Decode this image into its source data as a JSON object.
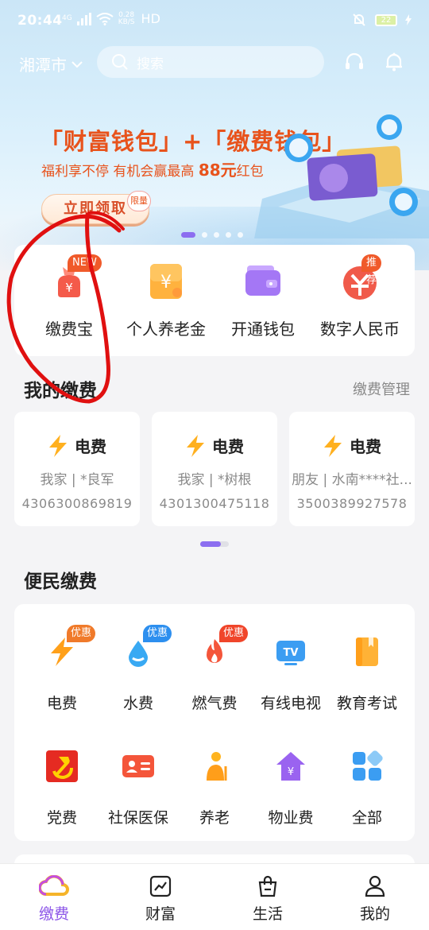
{
  "status_bar": {
    "time": "20:44",
    "network": "4G",
    "speed_value": "0.28",
    "speed_unit": "KB/S",
    "hd": "HD",
    "battery": "22"
  },
  "header": {
    "city": "湘潭市",
    "search_placeholder": "搜索"
  },
  "banner": {
    "title": "「财富钱包」+「缴费钱包」",
    "subtitle_pre": "福利享不停 有机会赢最高",
    "subtitle_amount": "88元",
    "subtitle_post": "红包",
    "claim_label": "立即领取",
    "limit_tag": "限量",
    "slides": 5,
    "active_slide": 1
  },
  "quick_actions": [
    {
      "label": "缴费宝",
      "badge": "NEW",
      "icon": "money-bag-icon"
    },
    {
      "label": "个人养老金",
      "badge": "",
      "icon": "yuan-box-icon"
    },
    {
      "label": "开通钱包",
      "badge": "",
      "icon": "wallet-icon"
    },
    {
      "label": "数字人民币",
      "badge": "推荐",
      "icon": "digital-rmb-icon"
    }
  ],
  "my_bills": {
    "title": "我的缴费",
    "manage_label": "缴费管理",
    "items": [
      {
        "type": "电费",
        "who": "我家 | *良军",
        "account": "4306300869819"
      },
      {
        "type": "电费",
        "who": "我家 | *树根",
        "account": "4301300475118"
      },
      {
        "type": "电费",
        "who": "朋友 | 水南****社...",
        "account": "3500389927578"
      }
    ]
  },
  "services": {
    "title": "便民缴费",
    "items": [
      {
        "label": "电费",
        "badge": "优惠",
        "icon": "lightning-icon"
      },
      {
        "label": "水费",
        "badge": "优惠",
        "icon": "water-drop-icon"
      },
      {
        "label": "燃气费",
        "badge": "优惠",
        "icon": "flame-icon"
      },
      {
        "label": "有线电视",
        "badge": "",
        "icon": "tv-icon"
      },
      {
        "label": "教育考试",
        "badge": "",
        "icon": "book-icon"
      },
      {
        "label": "党费",
        "badge": "",
        "icon": "party-emblem-icon"
      },
      {
        "label": "社保医保",
        "badge": "",
        "icon": "id-card-icon"
      },
      {
        "label": "养老",
        "badge": "",
        "icon": "elderly-icon"
      },
      {
        "label": "物业费",
        "badge": "",
        "icon": "house-icon"
      },
      {
        "label": "全部",
        "badge": "",
        "icon": "grid-icon"
      }
    ]
  },
  "tabs": [
    {
      "label": "缴费",
      "active": true,
      "icon": "cloud-icon"
    },
    {
      "label": "财富",
      "active": false,
      "icon": "chart-icon"
    },
    {
      "label": "生活",
      "active": false,
      "icon": "shopping-bag-icon"
    },
    {
      "label": "我的",
      "active": false,
      "icon": "user-icon"
    }
  ],
  "colors": {
    "accent": "#8c55e8",
    "promo": "#e8531c",
    "badge": "#f05a2a",
    "annotation": "#e01010"
  }
}
